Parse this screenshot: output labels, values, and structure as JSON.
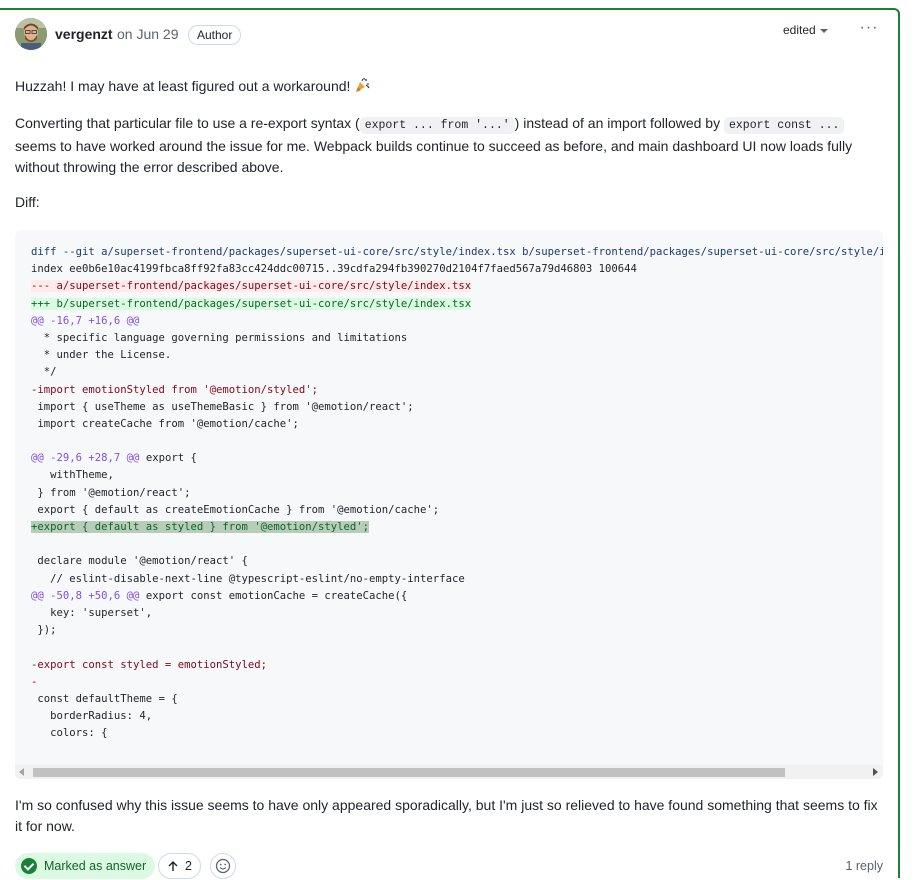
{
  "comment": {
    "author": "vergenzt",
    "timestamp": "on Jun 29",
    "badge": "Author",
    "edited_label": "edited",
    "more_label": "···"
  },
  "body": {
    "p1": "Huzzah! I may have at least figured out a workaround!",
    "p2_a": "Converting that particular file to use a re-export syntax (",
    "p2_code1": "export ... from '...'",
    "p2_b": ") instead of an import followed by",
    "p2_code2": "export const ...",
    "p2_c": "seems to have worked around the issue for me. Webpack builds continue to succeed as before, and main dashboard UI now loads fully without throwing the error described above.",
    "p3": "Diff:",
    "p4": "I'm so confused why this issue seems to have only appeared sporadically, but I'm just so relieved to have found something that seems to fix it for now."
  },
  "diff_lines": [
    {
      "kind": "meta",
      "text": "diff --git a/superset-frontend/packages/superset-ui-core/src/style/index.tsx b/superset-frontend/packages/superset-ui-core/src/style/index.tsx"
    },
    {
      "kind": "plain",
      "text": "index ee0b6e10ac4199fbca8ff92fa83cc424ddc00715..39cdfa294fb390270d2104f7faed567a79d46803 100644"
    },
    {
      "kind": "del",
      "text": "--- a/superset-frontend/packages/superset-ui-core/src/style/index.tsx"
    },
    {
      "kind": "add",
      "text": "+++ b/superset-frontend/packages/superset-ui-core/src/style/index.tsx"
    },
    {
      "kind": "hunk",
      "text": "@@ -16,7 +16,6 @@"
    },
    {
      "kind": "plain",
      "text": "  * specific language governing permissions and limitations"
    },
    {
      "kind": "plain",
      "text": "  * under the License."
    },
    {
      "kind": "plain",
      "text": "  */"
    },
    {
      "kind": "deltext",
      "text": "-import emotionStyled from '@emotion/styled';"
    },
    {
      "kind": "plain",
      "text": " import { useTheme as useThemeBasic } from '@emotion/react';"
    },
    {
      "kind": "plain",
      "text": " import createCache from '@emotion/cache';"
    },
    {
      "kind": "plain",
      "text": " "
    },
    {
      "kind": "hunkctx",
      "hunk": "@@ -29,6 +28,7 @@",
      "text": " export {"
    },
    {
      "kind": "plain",
      "text": "   withTheme,"
    },
    {
      "kind": "plain",
      "text": " } from '@emotion/react';"
    },
    {
      "kind": "plain",
      "text": " export { default as createEmotionCache } from '@emotion/cache';"
    },
    {
      "kind": "addhl",
      "text": "+export { default as styled } from '@emotion/styled';"
    },
    {
      "kind": "plain",
      "text": " "
    },
    {
      "kind": "plain",
      "text": " declare module '@emotion/react' {"
    },
    {
      "kind": "plain",
      "text": "   // eslint-disable-next-line @typescript-eslint/no-empty-interface"
    },
    {
      "kind": "hunkctx",
      "hunk": "@@ -50,8 +50,6 @@",
      "text": " export const emotionCache = createCache({"
    },
    {
      "kind": "plain",
      "text": "   key: 'superset',"
    },
    {
      "kind": "plain",
      "text": " });"
    },
    {
      "kind": "plain",
      "text": " "
    },
    {
      "kind": "deltext",
      "text": "-export const styled = emotionStyled;"
    },
    {
      "kind": "deltext",
      "text": "-"
    },
    {
      "kind": "plain",
      "text": " const defaultTheme = {"
    },
    {
      "kind": "plain",
      "text": "   borderRadius: 4,"
    },
    {
      "kind": "plain",
      "text": "   colors: {"
    }
  ],
  "footer": {
    "answer_label": "Marked as answer",
    "upvotes": "2",
    "reply_count": "1 reply"
  },
  "colors": {
    "accent_green": "#1a7f37",
    "diff_add_bg": "#dafbe1",
    "diff_del_bg": "#ffebe9",
    "hunk_purple": "#8250df"
  }
}
